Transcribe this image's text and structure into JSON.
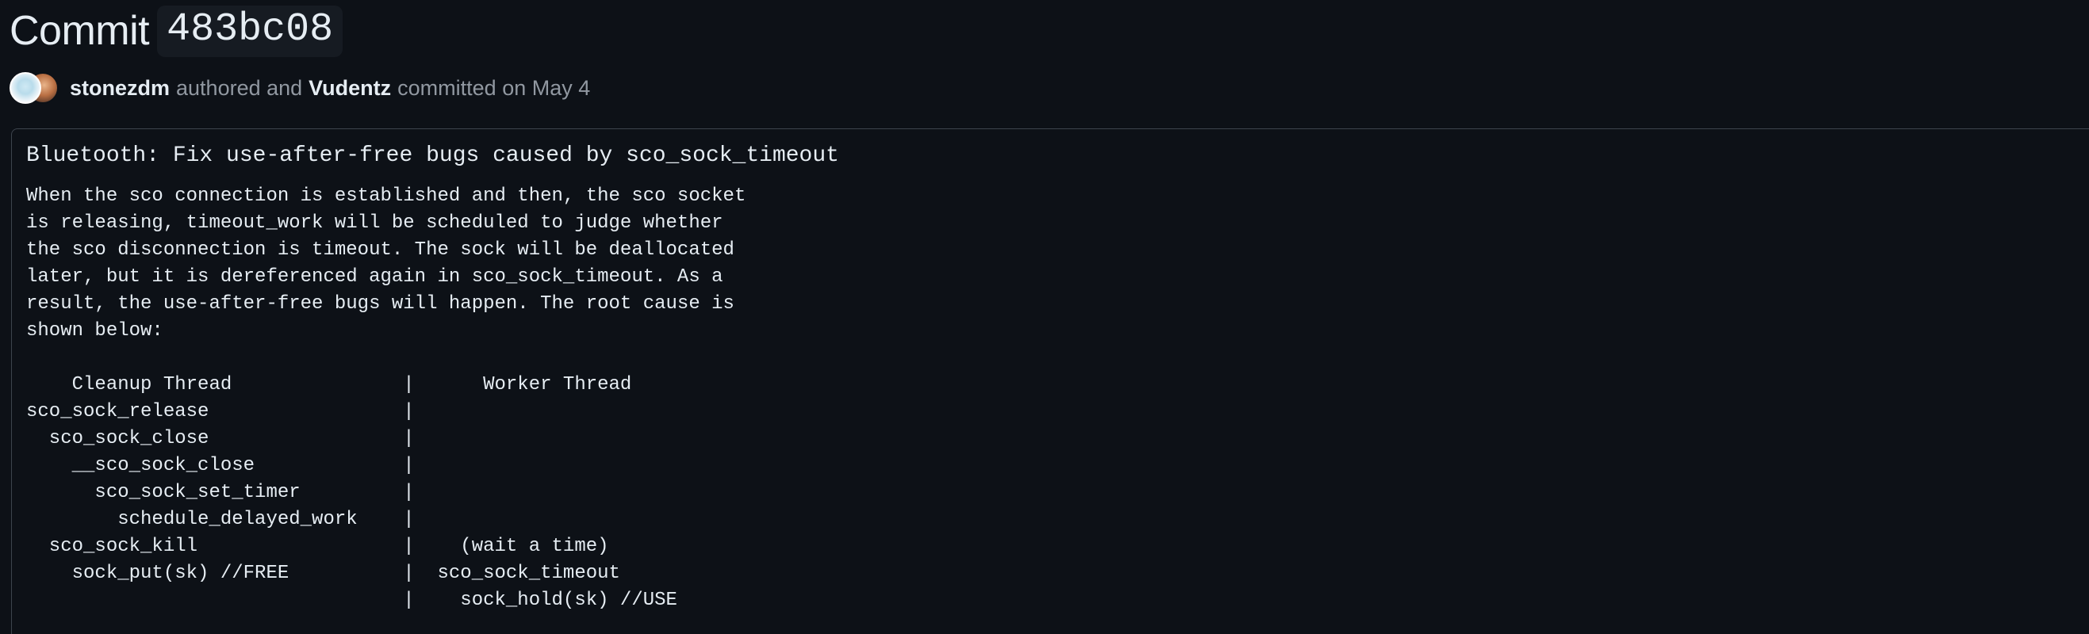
{
  "commit": {
    "title_label": "Commit",
    "sha": "483bc08"
  },
  "meta": {
    "author": "stonezdm",
    "authored_text": "authored and",
    "committer": "Vudentz",
    "committed_text": "committed on May 4"
  },
  "message": {
    "subject": "Bluetooth: Fix use-after-free bugs caused by sco_sock_timeout",
    "body": "When the sco connection is established and then, the sco socket\nis releasing, timeout_work will be scheduled to judge whether\nthe sco disconnection is timeout. The sock will be deallocated\nlater, but it is dereferenced again in sco_sock_timeout. As a\nresult, the use-after-free bugs will happen. The root cause is\nshown below:\n\n    Cleanup Thread               |      Worker Thread\nsco_sock_release                 |\n  sco_sock_close                 |\n    __sco_sock_close             |\n      sco_sock_set_timer         |\n        schedule_delayed_work    |\n  sco_sock_kill                  |    (wait a time)\n    sock_put(sk) //FREE          |  sco_sock_timeout\n                                 |    sock_hold(sk) //USE"
  },
  "icons": {
    "author_avatar": "avatar-image",
    "committer_avatar": "avatar-image"
  }
}
